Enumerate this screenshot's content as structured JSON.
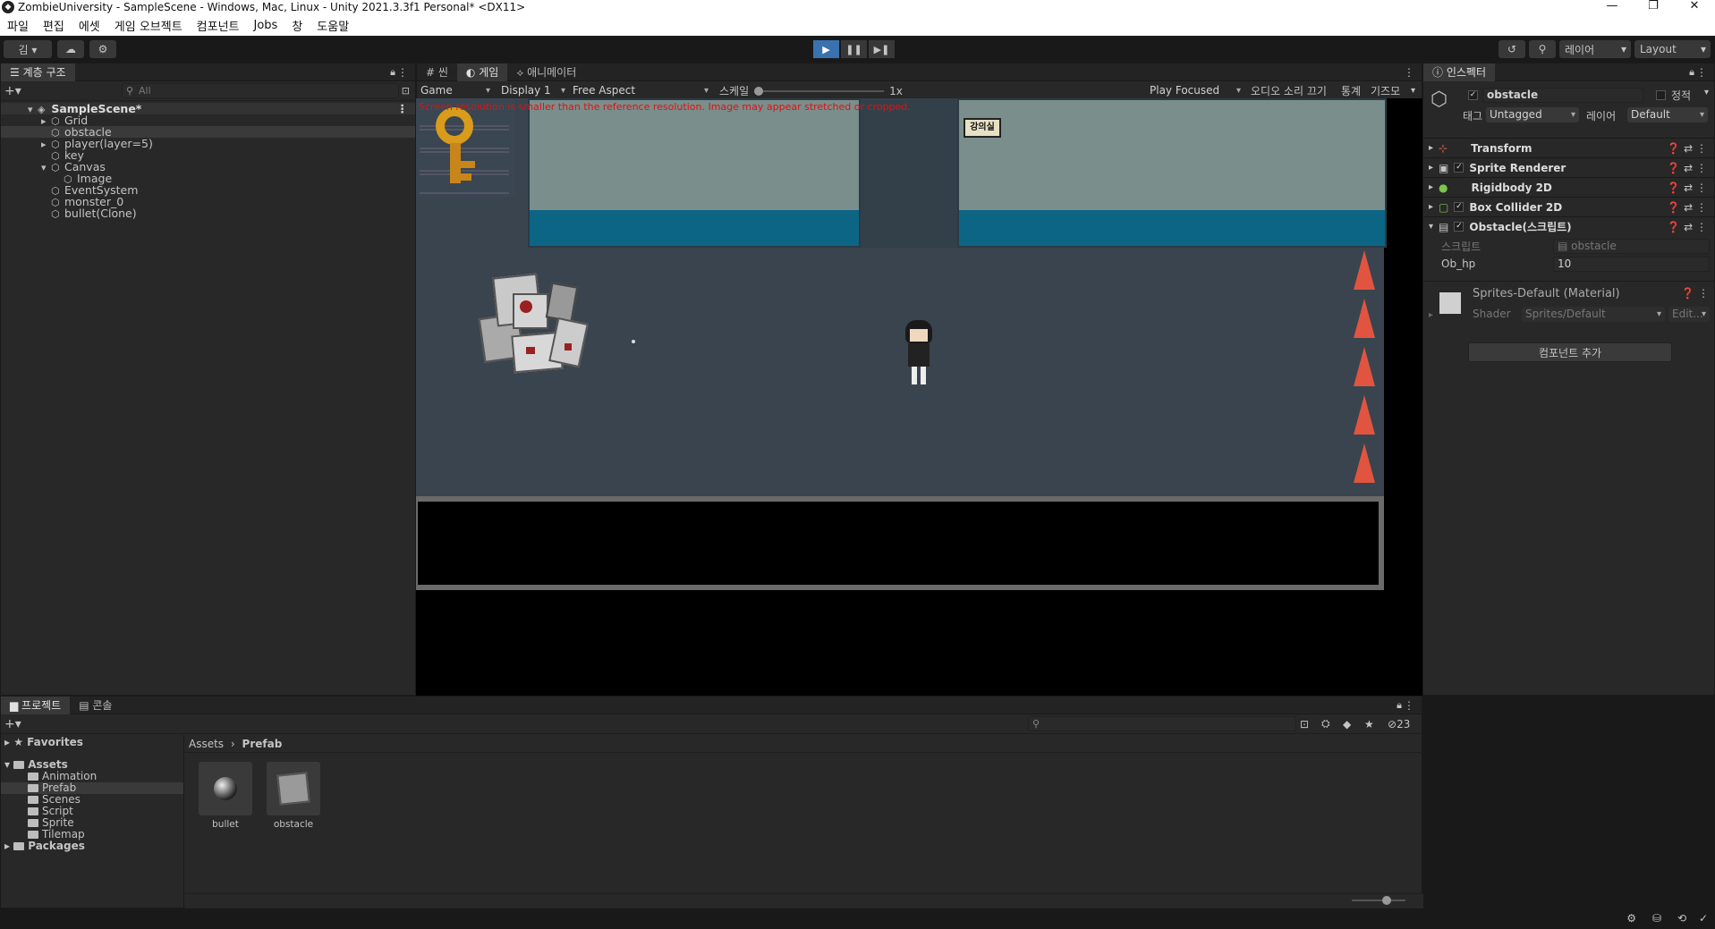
{
  "window": {
    "title": "ZombieUniversity - SampleScene - Windows, Mac, Linux - Unity 2021.3.3f1 Personal* <DX11>",
    "controls": [
      "—",
      "❐",
      "✕"
    ]
  },
  "menu": [
    "파일",
    "편집",
    "에셋",
    "게임 오브젝트",
    "컴포넌트",
    "Jobs",
    "창",
    "도움말"
  ],
  "toolbar": {
    "account": "김 ▾",
    "cloud_icon": "cloud-icon",
    "layers": "레이어",
    "layout": "Layout",
    "play_buttons": [
      "▶",
      "❚❚",
      "▶❚"
    ]
  },
  "hierarchy": {
    "tab": "계층 구조",
    "search_placeholder": "All",
    "scene": "SampleScene*",
    "items": [
      "Grid",
      "obstacle",
      "player(layer=5)",
      "key",
      "Canvas",
      "Image",
      "EventSystem",
      "monster_0",
      "bullet(Clone)"
    ]
  },
  "game_view": {
    "tabs": [
      "씬",
      "게임",
      "애니메이터"
    ],
    "mode": "Game",
    "display": "Display 1",
    "aspect": "Free Aspect",
    "scale_label": "스케일",
    "scale_value": "1x",
    "play_focused": "Play Focused",
    "mute": "오디오 소리 끄기",
    "stats": "통계",
    "gizmos": "기즈모",
    "warning": "Screen resolution is smaller than the reference resolution. Image may appear stretched or cropped.",
    "sign_text": "강의실"
  },
  "inspector": {
    "tab": "인스펙터",
    "object_name": "obstacle",
    "static_label": "정적",
    "tag_label": "태그",
    "tag_value": "Untagged",
    "layer_label": "레이어",
    "layer_value": "Default",
    "components": [
      "Transform",
      "Sprite Renderer",
      "Rigidbody 2D",
      "Box Collider 2D",
      "Obstacle(스크립트)"
    ],
    "script_label": "스크립트",
    "script_value": "obstacle",
    "ob_hp_label": "Ob_hp",
    "ob_hp_value": "10",
    "material_name": "Sprites-Default (Material)",
    "shader_label": "Shader",
    "shader_value": "Sprites/Default",
    "edit_label": "Edit...",
    "add_component": "컴포넌트 추가"
  },
  "project": {
    "tabs": [
      "프로젝트",
      "콘솔"
    ],
    "favorites": "Favorites",
    "assets": "Assets",
    "folders": [
      "Animation",
      "Prefab",
      "Scenes",
      "Script",
      "Sprite",
      "Tilemap"
    ],
    "packages": "Packages",
    "breadcrumb": [
      "Assets",
      "Prefab"
    ],
    "items": [
      "bullet",
      "obstacle"
    ],
    "hidden_count": "23"
  }
}
